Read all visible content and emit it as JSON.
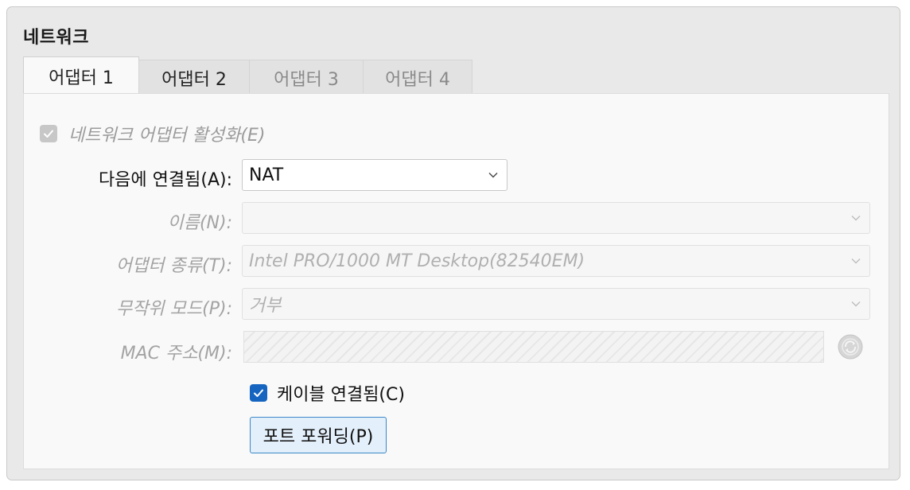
{
  "panel": {
    "title": "네트워크"
  },
  "tabs": [
    {
      "label": "어댑터 1",
      "active": true,
      "enabled": true
    },
    {
      "label": "어댑터 2",
      "active": false,
      "enabled": true
    },
    {
      "label": "어댑터 3",
      "active": false,
      "enabled": false
    },
    {
      "label": "어댑터 4",
      "active": false,
      "enabled": false
    }
  ],
  "adapter": {
    "enable_label": "네트워크 어댑터 활성화(E)",
    "enable_checked": true,
    "enable_disabled": true,
    "attached_to": {
      "label": "다음에 연결됨(A):",
      "value": "NAT"
    },
    "name": {
      "label": "이름(N):",
      "value": ""
    },
    "adapter_type": {
      "label": "어댑터 종류(T):",
      "value": "Intel PRO/1000 MT Desktop(82540EM)"
    },
    "promiscuous_mode": {
      "label": "무작위 모드(P):",
      "value": "거부"
    },
    "mac_address": {
      "label": "MAC 주소(M):",
      "value": ""
    },
    "cable_connected": {
      "label": "케이블 연결됨(C)",
      "checked": true
    },
    "port_forwarding_label": "포트 포워딩(P)"
  },
  "colors": {
    "accent": "#1565c0",
    "button_border": "#3a87c8",
    "button_bg": "#e3effa",
    "disabled_text": "#a3a3a3"
  },
  "icons": {
    "select_arrow": "chevron-down-icon",
    "enable_check": "checkmark-icon",
    "mac_refresh": "refresh-icon"
  }
}
